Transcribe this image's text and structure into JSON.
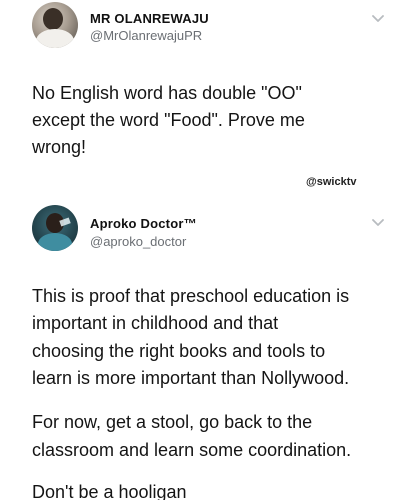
{
  "tweets": [
    {
      "name": "MR OLANREWAJU",
      "handle": "@MrOlanrewajuPR",
      "lines": [
        "No English word has double \"OO\"",
        "except the word \"Food\".  Prove me",
        "wrong!"
      ],
      "watermark": "@swicktv"
    },
    {
      "name": "Aproko Doctor™",
      "handle": "@aproko_doctor",
      "lines": [
        "This is proof that preschool education is",
        "important in childhood and that",
        "choosing the right books and tools to",
        "learn is more important than Nollywood.",
        "For now, get a stool, go back to the",
        "classroom and learn some coordination.",
        "Don't be a hooligan"
      ]
    }
  ],
  "colors": {
    "background": "#ffffff",
    "text": "#141414",
    "handle": "#6b6f74",
    "chevron": "#b8bcc0"
  },
  "icons": [
    "chevron-down-icon"
  ]
}
